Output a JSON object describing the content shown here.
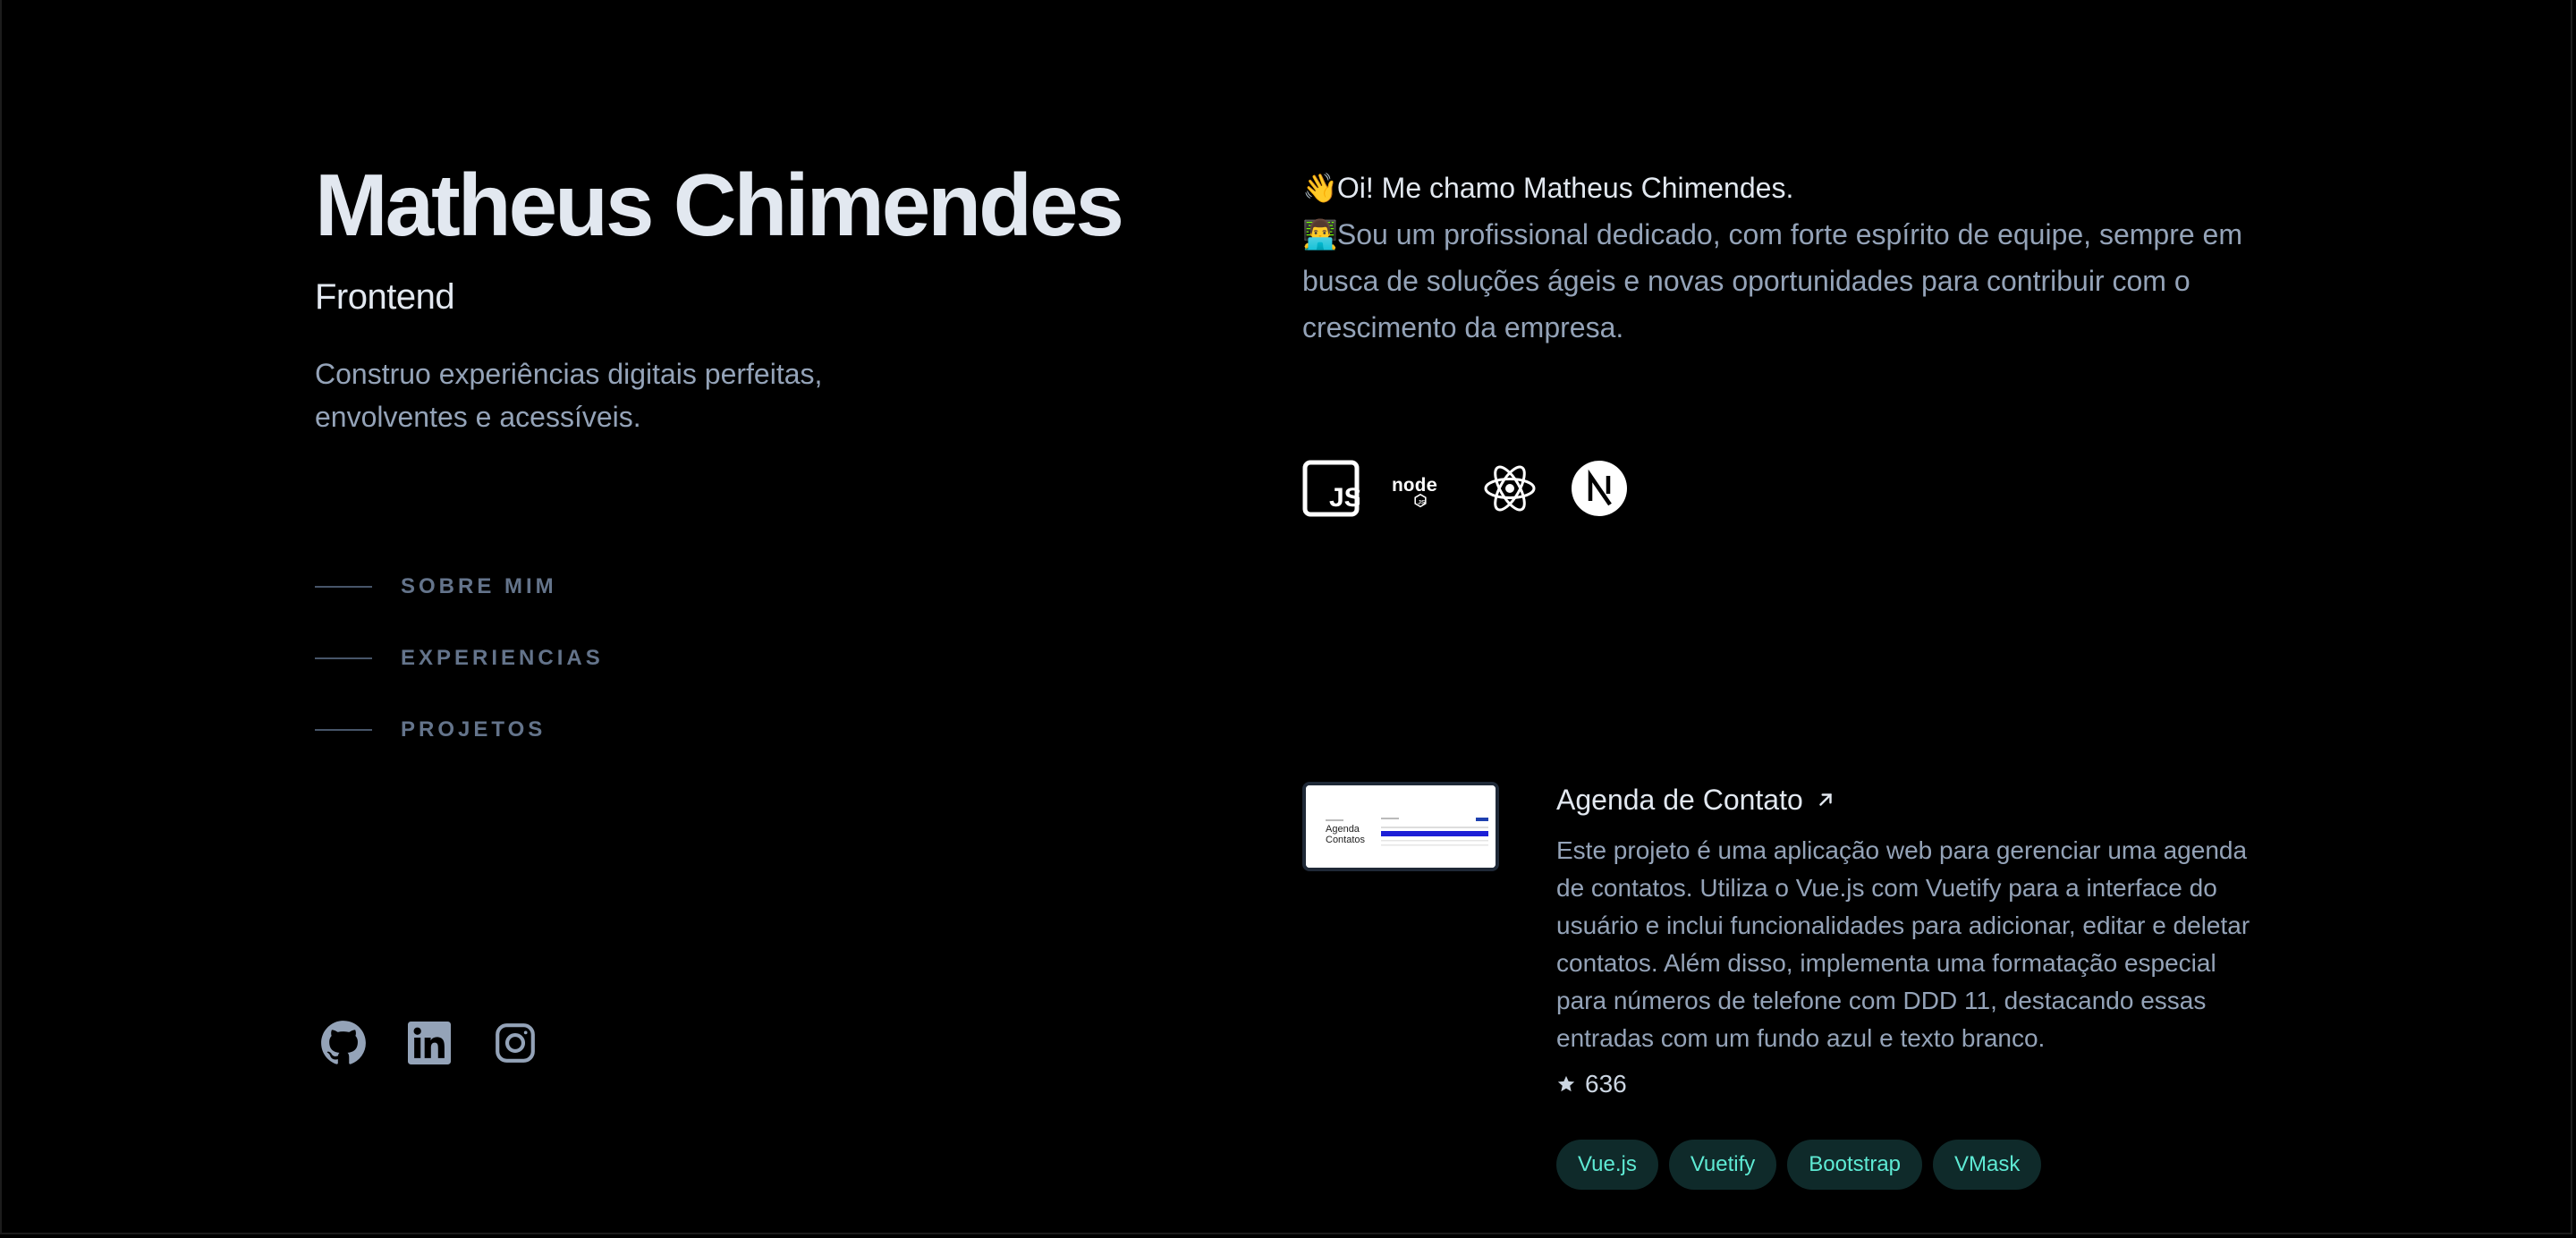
{
  "profile": {
    "name": "Matheus Chimendes",
    "role": "Frontend",
    "tagline": "Construo experiências digitais perfeitas, envolventes e acessíveis."
  },
  "nav": {
    "items": [
      {
        "label": "SOBRE MIM"
      },
      {
        "label": "EXPERIENCIAS"
      },
      {
        "label": "PROJETOS"
      }
    ]
  },
  "socials": [
    "github-icon",
    "linkedin-icon",
    "instagram-icon"
  ],
  "about": {
    "greeting_emoji": "👋",
    "greeting": "Oi! Me chamo Matheus Chimendes.",
    "bio_emoji": "👨‍💻",
    "bio": "Sou um profissional dedicado, com forte espírito de equipe, sempre em busca de soluções ágeis e novas oportunidades para contribuir com o crescimento da empresa."
  },
  "tech": [
    "javascript-icon",
    "nodejs-icon",
    "react-icon",
    "nextjs-icon"
  ],
  "project": {
    "title": "Agenda de Contato",
    "title_arrow": "↗",
    "description": "Este projeto é uma aplicação web para gerenciar uma agenda de contatos. Utiliza o Vue.js com Vuetify para a interface do usuário e inclui funcionalidades para adicionar, editar e deletar contatos. Além disso, implementa uma formatação especial para números de telefone com DDD 11, destacando essas entradas com um fundo azul e texto branco.",
    "stars": "636",
    "thumb_title_line1": "Agenda",
    "thumb_title_line2": "Contatos",
    "tags": [
      "Vue.js",
      "Vuetify",
      "Bootstrap",
      "VMask"
    ]
  },
  "colors": {
    "background": "#000000",
    "heading": "#e2e8f0",
    "muted": "#94a3b8",
    "nav": "#64748b",
    "tag_bg": "#0f2a2a",
    "tag_text": "#5eead4"
  }
}
